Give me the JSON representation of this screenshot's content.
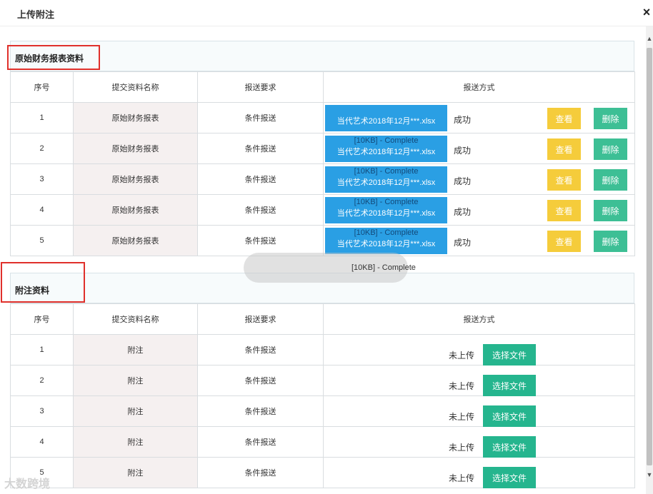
{
  "dialog": {
    "title": "上传附注",
    "close_glyph": "×"
  },
  "headers": {
    "seq": "序号",
    "name": "提交资料名称",
    "req": "报送要求",
    "method": "报送方式"
  },
  "section1": {
    "title": "原始财务报表资料",
    "rows": [
      {
        "seq": "1",
        "name": "原始财务报表",
        "req": "条件报送",
        "file": "当代艺术2018年12月***.xlsx",
        "complete": "",
        "status": "成功",
        "view": "查看",
        "del": "删除"
      },
      {
        "seq": "2",
        "name": "原始财务报表",
        "req": "条件报送",
        "file": "当代艺术2018年12月***.xlsx",
        "complete": "[10KB] - Complete",
        "status": "成功",
        "view": "查看",
        "del": "删除"
      },
      {
        "seq": "3",
        "name": "原始财务报表",
        "req": "条件报送",
        "file": "当代艺术2018年12月***.xlsx",
        "complete": "[10KB] - Complete",
        "status": "成功",
        "view": "查看",
        "del": "删除"
      },
      {
        "seq": "4",
        "name": "原始财务报表",
        "req": "条件报送",
        "file": "当代艺术2018年12月***.xlsx",
        "complete": "[10KB] - Complete",
        "status": "成功",
        "view": "查看",
        "del": "删除"
      },
      {
        "seq": "5",
        "name": "原始财务报表",
        "req": "条件报送",
        "file": "当代艺术2018年12月***.xlsx",
        "complete": "[10KB] - Complete",
        "status": "成功",
        "view": "查看",
        "del": "删除"
      }
    ],
    "trailing_complete": "[10KB] - Complete"
  },
  "section2": {
    "title": "附注资料",
    "rows": [
      {
        "seq": "1",
        "name": "附注",
        "req": "条件报送",
        "status": "未上传",
        "choose": "选择文件"
      },
      {
        "seq": "2",
        "name": "附注",
        "req": "条件报送",
        "status": "未上传",
        "choose": "选择文件"
      },
      {
        "seq": "3",
        "name": "附注",
        "req": "条件报送",
        "status": "未上传",
        "choose": "选择文件"
      },
      {
        "seq": "4",
        "name": "附注",
        "req": "条件报送",
        "status": "未上传",
        "choose": "选择文件"
      },
      {
        "seq": "5",
        "name": "附注",
        "req": "条件报送",
        "status": "未上传",
        "choose": "选择文件"
      }
    ]
  },
  "watermark": "大数跨境",
  "colors": {
    "view": "#f5cc3b",
    "delete": "#3dbf95",
    "choose": "#25b58e",
    "file_chip": "#2a9fe4",
    "highlight": "#e0302b"
  }
}
